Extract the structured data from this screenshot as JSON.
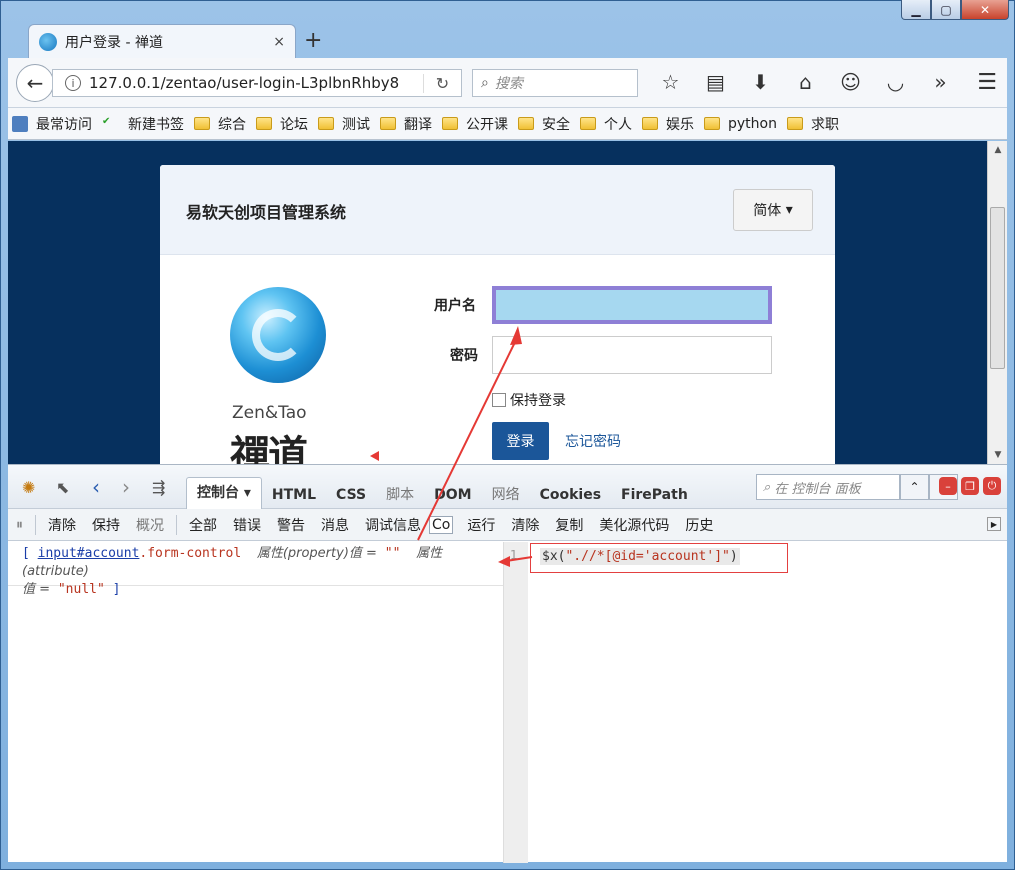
{
  "window": {
    "minimize_icon": "minimize-icon",
    "maximize_icon": "maximize-icon",
    "close_icon": "close-icon"
  },
  "tab": {
    "title": "用户登录 - 禅道",
    "close": "×",
    "new_tab": "+"
  },
  "navbar": {
    "url": "127.0.0.1/zentao/user-login-L3plbnRhby8",
    "search_placeholder": "搜索"
  },
  "bookmarks": [
    {
      "label": "最常访问",
      "icon": "most-visited-icon"
    },
    {
      "label": "新建书签",
      "icon": "hao-icon"
    },
    {
      "label": "综合",
      "icon": "folder-icon"
    },
    {
      "label": "论坛",
      "icon": "folder-icon"
    },
    {
      "label": "测试",
      "icon": "folder-icon"
    },
    {
      "label": "翻译",
      "icon": "folder-icon"
    },
    {
      "label": "公开课",
      "icon": "folder-icon"
    },
    {
      "label": "安全",
      "icon": "folder-icon"
    },
    {
      "label": "个人",
      "icon": "folder-icon"
    },
    {
      "label": "娱乐",
      "icon": "folder-icon"
    },
    {
      "label": "python",
      "icon": "folder-icon"
    },
    {
      "label": "求职",
      "icon": "folder-icon"
    }
  ],
  "login": {
    "title": "易软天创项目管理系统",
    "lang_button": "简体",
    "logo_text": "Zen&Tao",
    "logo_cn": "禪道",
    "user_label": "用户名",
    "pass_label": "密码",
    "remember_label": "保持登录",
    "login_button": "登录",
    "forgot_link": "忘记密码"
  },
  "devtools": {
    "tabs": [
      {
        "label": "控制台 ▾",
        "active": true
      },
      {
        "label": "HTML"
      },
      {
        "label": "CSS"
      },
      {
        "label": "脚本",
        "dim": true
      },
      {
        "label": "DOM"
      },
      {
        "label": "网络",
        "dim": true
      },
      {
        "label": "Cookies"
      },
      {
        "label": "FirePath"
      }
    ],
    "search_placeholder": "在 控制台 面板",
    "subbar": {
      "clear": "清除",
      "persist": "保持",
      "profile": "概况",
      "all": "全部",
      "errors": "错误",
      "warnings": "警告",
      "info": "消息",
      "debug": "调试信息",
      "cookies_short": "Co",
      "run": "运行",
      "clear2": "清除",
      "copy": "复制",
      "beautify": "美化源代码",
      "history": "历史"
    },
    "log": {
      "open_bracket": "[",
      "node": "input#account",
      "cls": ".form-control",
      "prop_label": "属性(property)值 =",
      "prop_value": "\"\"",
      "attr_label": "属性(attribute)",
      "attr_value_label": "值 =",
      "attr_value": "\"null\"",
      "close_bracket": "]"
    },
    "gutter_line": "1",
    "command": {
      "prefix": "$x(",
      "string": "\".//*[@id='account']\"",
      "suffix": ")"
    }
  }
}
